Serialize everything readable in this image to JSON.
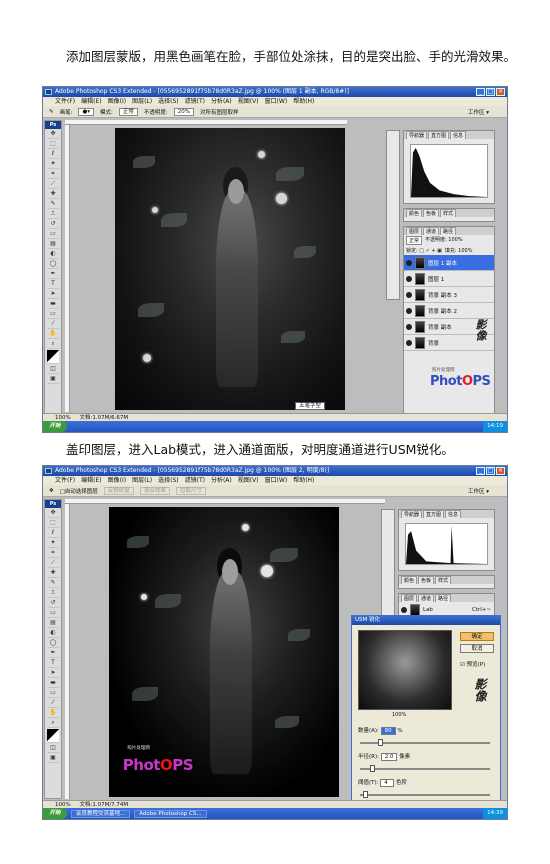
{
  "caption1": "添加图层蒙版，用黑色画笔在脸，手部位处涂抹，目的是突出脸、手的光滑效果。",
  "caption2": "盖印图层，进入Lab模式，进入通道面版，对明度通道进行USM锐化。",
  "shot1": {
    "title": "Adobe Photoshop CS3 Extended - [0556952891f75b78d0R3aZ.jpg @ 100% (图层 1 副本, RGB/8#)]",
    "menus": [
      "文件(F)",
      "编辑(E)",
      "图像(I)",
      "图层(L)",
      "选择(S)",
      "滤镜(T)",
      "分析(A)",
      "视图(V)",
      "窗口(W)",
      "帮助(H)"
    ],
    "options": {
      "brush_label": "画笔:",
      "mode_label": "模式:",
      "mode_value": "正常",
      "opacity_label": "不透明度:",
      "opacity_value": "20%",
      "checkbox_label": "对所有图层取样",
      "workspace": "工作区 ▾"
    },
    "panel_tabs": [
      "导航器",
      "直方图",
      "信息"
    ],
    "color_tabs": [
      "颜色",
      "色板",
      "样式"
    ],
    "layer_tabs": [
      "图层",
      "通道",
      "路径"
    ],
    "blend_mode": "正常",
    "opacity": "不透明度: 100%",
    "lock": "锁定: □ ✓ + ▣",
    "fill": "填充: 100%",
    "layers": [
      {
        "name": "图层 1 副本",
        "selected": true
      },
      {
        "name": "图层 1",
        "selected": false
      },
      {
        "name": "背景 副本 3",
        "selected": false
      },
      {
        "name": "背景 副本 2",
        "selected": false
      },
      {
        "name": "背景 副本",
        "selected": false
      },
      {
        "name": "背景",
        "selected": false
      }
    ],
    "status_zoom": "100%",
    "status_doc": "文档:1.07M/6.67M",
    "ime": "五笔字型",
    "start": "开始",
    "tray_time": "14:19",
    "logo_sub": "照片处理网",
    "logo": "PhotoPS"
  },
  "shot2": {
    "title": "Adobe Photoshop CS3 Extended - [0556952891f75b78d0R3aZ.jpg @ 100% (图层 2, 明度/8)]",
    "menus": [
      "文件(F)",
      "编辑(E)",
      "图像(I)",
      "图层(L)",
      "选择(S)",
      "滤镜(T)",
      "分析(A)",
      "视图(V)",
      "窗口(W)",
      "帮助(H)"
    ],
    "options": {
      "auto_select": "□自动选择图层",
      "b1": "反斜修复",
      "b2": "混合效果",
      "b3": "拉取尺寸",
      "workspace": "工作区 ▾"
    },
    "panel_tabs": [
      "导航器",
      "直方图",
      "信息"
    ],
    "color_tabs": [
      "颜色",
      "色板",
      "样式"
    ],
    "channel_tabs": [
      "图层",
      "通道",
      "路径"
    ],
    "channel_row": {
      "name": "Lab",
      "shortcut": "Ctrl+~"
    },
    "dialog": {
      "title": "USM 锐化",
      "ok": "确定",
      "cancel": "取消",
      "preview": "☑ 预览(P)",
      "zoom": "100%",
      "amount_label": "数量(A):",
      "amount_value": "80",
      "amount_unit": "%",
      "radius_label": "半径(R):",
      "radius_value": "2.0",
      "radius_unit": "像素",
      "threshold_label": "阈值(T):",
      "threshold_value": "4",
      "threshold_unit": "色阶"
    },
    "status_zoom": "100%",
    "status_doc": "文档:1.07M/7.74M",
    "start": "开始",
    "task1": "会员教程交流基地...",
    "task2": "Adobe Photoshop CS...",
    "tray_time": "14:39",
    "logo_sub": "照片处理网",
    "logo": "PhotoPS"
  },
  "colors": {
    "accent": "#3d6fd0",
    "selected": "#3a6ee0",
    "logo_o": "#e02020"
  },
  "icons": [
    "photoshop-icon",
    "brush-icon",
    "eye-icon",
    "windows-start-icon"
  ]
}
